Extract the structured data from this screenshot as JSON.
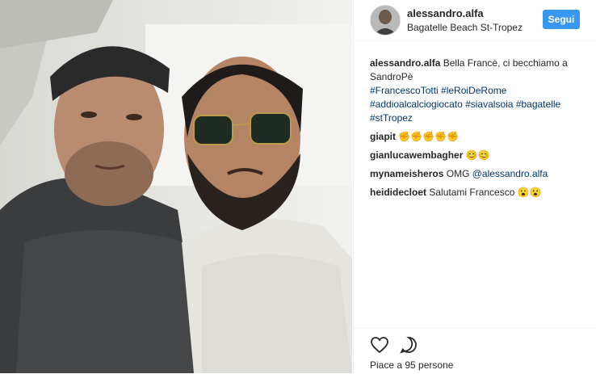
{
  "post": {
    "header": {
      "username": "alessandro.alfa",
      "location": "Bagatelle Beach St-Tropez",
      "follow_label": "Segui"
    },
    "caption": {
      "username": "alessandro.alfa",
      "text": "Bella Francè, ci becchiamo a SandroPè",
      "hashtags": [
        "#FrancescoTotti",
        "#leRoiDeRome",
        "#addioalcalciogiocato",
        "#siavalsoia",
        "#bagatelle",
        "#stTropez"
      ]
    },
    "comments": [
      {
        "username": "giapit",
        "text": "✊✊✊✊✊",
        "mention": ""
      },
      {
        "username": "gianlucawembagher",
        "text": "😊😊",
        "mention": ""
      },
      {
        "username": "mynameisheros",
        "text": "OMG ",
        "mention": "@alessandro.alfa"
      },
      {
        "username": "heididecloet",
        "text": "Salutami Francesco 😮😮",
        "mention": ""
      }
    ],
    "likes_text": "Piace a 95 persone",
    "icons": {
      "like": "heart-icon",
      "comment": "comment-icon"
    }
  }
}
